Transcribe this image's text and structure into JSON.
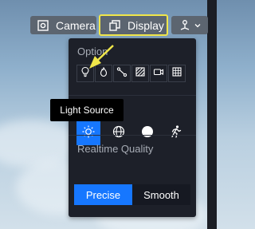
{
  "toolbar": {
    "camera_label": "Camera",
    "display_label": "Display"
  },
  "panel": {
    "options_title": "Option",
    "quality_title": "Realtime Quality",
    "quality_options": [
      "Precise",
      "Smooth"
    ],
    "quality_selected": "Precise",
    "option_icons": [
      "light-bulb-icon",
      "fire-icon",
      "path-icon",
      "texture-icon",
      "video-camera-icon",
      "grid-icon"
    ],
    "mode_icons": [
      "sun-icon",
      "globe-icon",
      "sphere-icon",
      "running-person-icon"
    ],
    "mode_selected": "sun-icon"
  },
  "tooltip": {
    "text": "Light Source"
  },
  "colors": {
    "accent": "#1677ff",
    "highlight": "#f0e64a"
  }
}
